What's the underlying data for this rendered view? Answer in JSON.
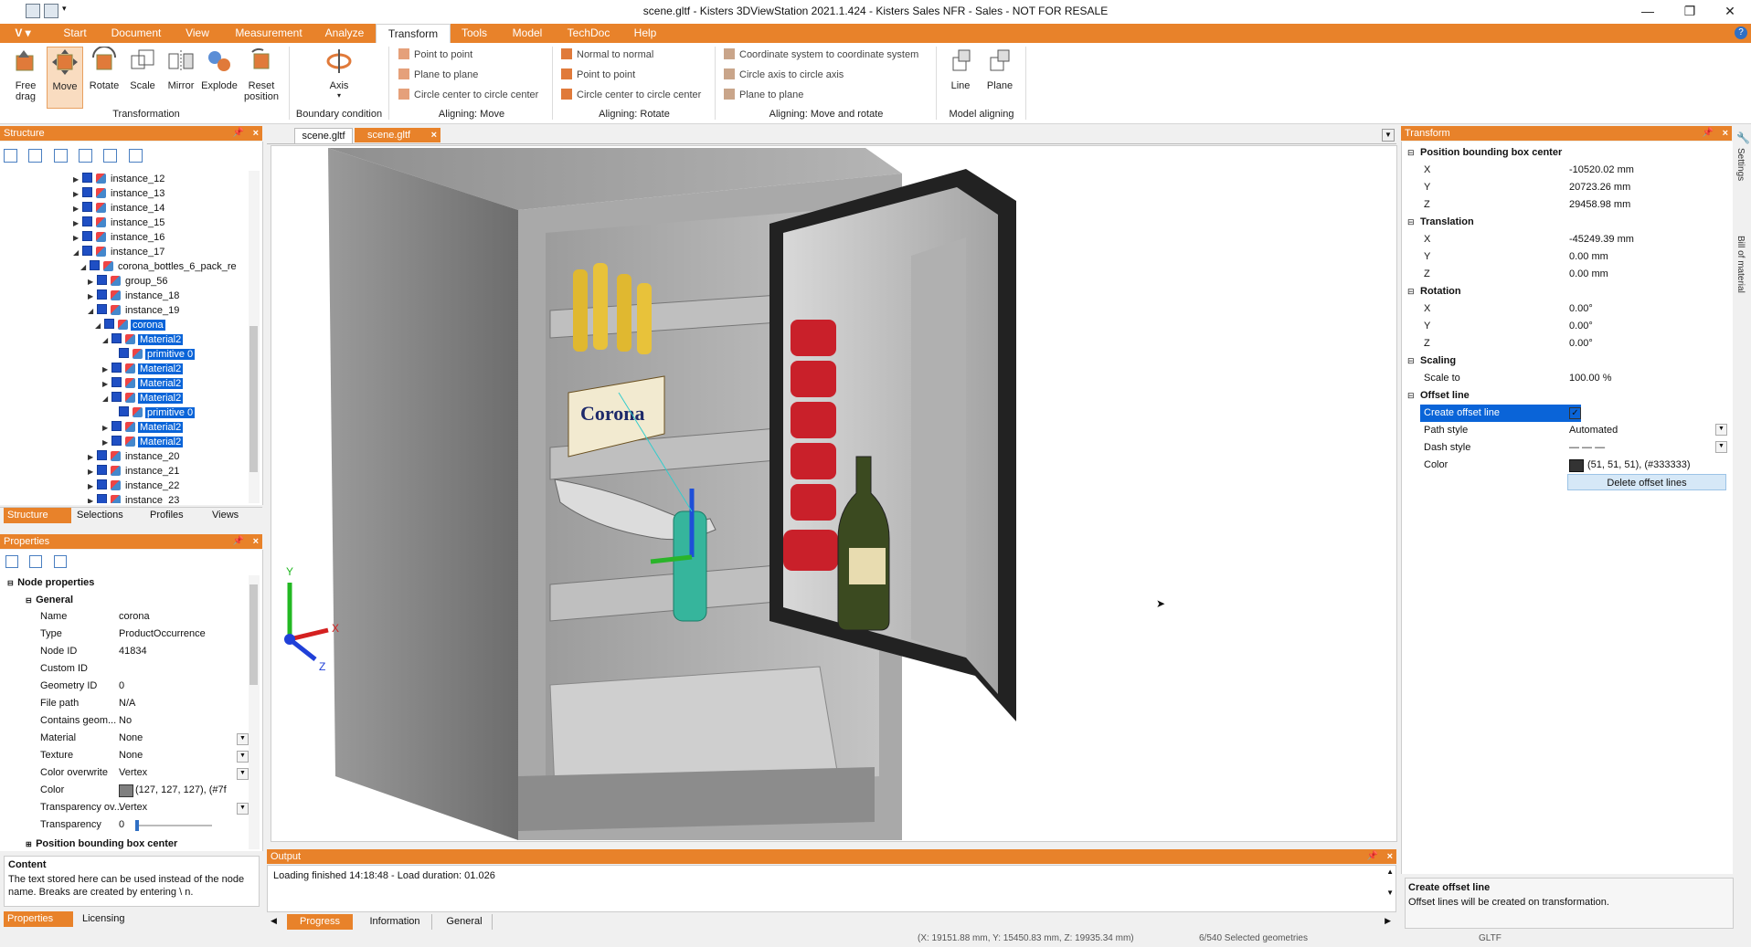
{
  "window": {
    "title": "scene.gltf - Kisters 3DViewStation 2021.1.424 - Kisters Sales NFR - Sales - NOT FOR RESALE",
    "controls": [
      "—",
      "❐",
      "✕"
    ]
  },
  "menu": {
    "app_button": "V",
    "tabs": [
      "Start",
      "Document",
      "View",
      "Measurement",
      "Analyze",
      "Transform",
      "Tools",
      "Model",
      "TechDoc",
      "Help"
    ],
    "active": "Transform"
  },
  "ribbon": {
    "transformation": {
      "buttons": [
        "Free\ndrag",
        "Move",
        "Rotate",
        "Scale",
        "Mirror",
        "Explode",
        "Reset\nposition"
      ],
      "label": "Transformation"
    },
    "boundary": {
      "button": "Axis",
      "label": "Boundary condition"
    },
    "aligning_move": {
      "items": [
        "Point to point",
        "Plane to plane",
        "Circle center to circle center"
      ],
      "label": "Aligning: Move"
    },
    "aligning_rotate": {
      "items": [
        "Normal to normal",
        "Point to point",
        "Circle center to circle center"
      ],
      "label": "Aligning: Rotate"
    },
    "aligning_move_rotate": {
      "items": [
        "Coordinate system to coordinate system",
        "Circle axis to circle axis",
        "Plane to plane"
      ],
      "label": "Aligning: Move and rotate"
    },
    "model_aligning": {
      "buttons": [
        "Line",
        "Plane"
      ],
      "label": "Model aligning"
    }
  },
  "structure": {
    "title": "Structure",
    "rows": [
      {
        "label": "instance_12",
        "indent": 0,
        "exp": "▶",
        "sel": false
      },
      {
        "label": "instance_13",
        "indent": 0,
        "exp": "▶",
        "sel": false
      },
      {
        "label": "instance_14",
        "indent": 0,
        "exp": "▶",
        "sel": false
      },
      {
        "label": "instance_15",
        "indent": 0,
        "exp": "▶",
        "sel": false
      },
      {
        "label": "instance_16",
        "indent": 0,
        "exp": "▶",
        "sel": false
      },
      {
        "label": "instance_17",
        "indent": 0,
        "exp": "◢",
        "sel": false
      },
      {
        "label": "corona_bottles_6_pack_re",
        "indent": 1,
        "exp": "◢",
        "sel": false
      },
      {
        "label": "group_56",
        "indent": 2,
        "exp": "▶",
        "sel": false
      },
      {
        "label": "instance_18",
        "indent": 2,
        "exp": "▶",
        "sel": false
      },
      {
        "label": "instance_19",
        "indent": 2,
        "exp": "◢",
        "sel": false
      },
      {
        "label": "corona",
        "indent": 3,
        "exp": "◢",
        "sel": true
      },
      {
        "label": "Material2",
        "indent": 4,
        "exp": "◢",
        "sel": true
      },
      {
        "label": "primitive 0",
        "indent": 5,
        "exp": "",
        "sel": true
      },
      {
        "label": "Material2",
        "indent": 4,
        "exp": "▶",
        "sel": true
      },
      {
        "label": "Material2",
        "indent": 4,
        "exp": "▶",
        "sel": true
      },
      {
        "label": "Material2",
        "indent": 4,
        "exp": "◢",
        "sel": true
      },
      {
        "label": "primitive 0",
        "indent": 5,
        "exp": "",
        "sel": true
      },
      {
        "label": "Material2",
        "indent": 4,
        "exp": "▶",
        "sel": true
      },
      {
        "label": "Material2",
        "indent": 4,
        "exp": "▶",
        "sel": true
      },
      {
        "label": "instance_20",
        "indent": 2,
        "exp": "▶",
        "sel": false
      },
      {
        "label": "instance_21",
        "indent": 2,
        "exp": "▶",
        "sel": false
      },
      {
        "label": "instance_22",
        "indent": 2,
        "exp": "▶",
        "sel": false
      },
      {
        "label": "instance_23",
        "indent": 2,
        "exp": "▶",
        "sel": false
      }
    ],
    "tabs": [
      "Structure",
      "Selections",
      "Profiles",
      "Views"
    ]
  },
  "properties": {
    "title": "Properties",
    "section": "Node properties",
    "group": "General",
    "rows": [
      {
        "k": "Name",
        "v": "corona",
        "dd": false
      },
      {
        "k": "Type",
        "v": "ProductOccurrence",
        "dd": false
      },
      {
        "k": "Node ID",
        "v": "41834",
        "dd": false
      },
      {
        "k": "Custom ID",
        "v": "",
        "dd": false
      },
      {
        "k": "Geometry ID",
        "v": "0",
        "dd": false
      },
      {
        "k": "File path",
        "v": "N/A",
        "dd": false
      },
      {
        "k": "Contains geom...",
        "v": "No",
        "dd": false
      },
      {
        "k": "Material",
        "v": "None",
        "dd": true
      },
      {
        "k": "Texture",
        "v": "None",
        "dd": true
      },
      {
        "k": "Color overwrite",
        "v": "Vertex",
        "dd": true
      },
      {
        "k": "Color",
        "v": "(127, 127, 127), (#7f",
        "dd": false,
        "swatch": "#7f7f7f"
      },
      {
        "k": "Transparency ov...",
        "v": "Vertex",
        "dd": true
      },
      {
        "k": "Transparency",
        "v": "0",
        "dd": false,
        "slider": true
      }
    ],
    "next_group": "Position bounding box center",
    "content_title": "Content",
    "content_text": "The text stored here can be used instead of the node name. Breaks are created by entering \\ n.",
    "tabs": [
      "Properties",
      "Licensing"
    ]
  },
  "viewport": {
    "tabs": [
      "scene.gltf",
      "scene.gltf"
    ],
    "axis_labels": [
      "Y",
      "X",
      "Z"
    ]
  },
  "output": {
    "title": "Output",
    "text": "Loading finished 14:18:48 - Load duration: 01.026",
    "tabs": [
      "Progress",
      "Information",
      "General"
    ]
  },
  "transform": {
    "title": "Transform",
    "sections": [
      {
        "title": "Position bounding box center",
        "rows": [
          {
            "k": "X",
            "v": "-10520.02 mm"
          },
          {
            "k": "Y",
            "v": "20723.26 mm"
          },
          {
            "k": "Z",
            "v": "29458.98 mm"
          }
        ]
      },
      {
        "title": "Translation",
        "rows": [
          {
            "k": "X",
            "v": "-45249.39 mm"
          },
          {
            "k": "Y",
            "v": "0.00 mm"
          },
          {
            "k": "Z",
            "v": "0.00 mm"
          }
        ]
      },
      {
        "title": "Rotation",
        "rows": [
          {
            "k": "X",
            "v": "0.00°"
          },
          {
            "k": "Y",
            "v": "0.00°"
          },
          {
            "k": "Z",
            "v": "0.00°"
          }
        ]
      },
      {
        "title": "Scaling",
        "rows": [
          {
            "k": "Scale to",
            "v": "100.00 %"
          }
        ]
      },
      {
        "title": "Offset line",
        "rows": [
          {
            "k": "Create offset line",
            "v": "✓",
            "sel": true
          },
          {
            "k": "Path style",
            "v": "Automated",
            "dd": true
          },
          {
            "k": "Dash style",
            "v": "— — —",
            "dd": true
          },
          {
            "k": "Color",
            "v": "(51, 51, 51), (#333333)",
            "swatch": "#333333"
          }
        ]
      }
    ],
    "delete_button": "Delete offset lines",
    "help_title": "Create offset line",
    "help_text": "Offset lines will be created on transformation.",
    "side_tabs": [
      "Settings",
      "Bill of material"
    ]
  },
  "status": {
    "coords": "(X: 19151.88 mm, Y: 15450.83 mm, Z: 19935.34 mm)",
    "selected": "6/540 Selected geometries",
    "format": "GLTF"
  },
  "colors": {
    "accent": "#e8822a",
    "selection": "#0a64d8"
  }
}
